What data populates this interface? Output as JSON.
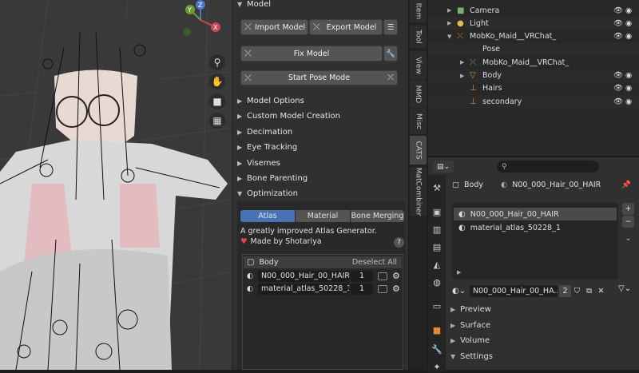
{
  "viewport": {
    "axes": {
      "x": "X",
      "y": "Y",
      "z": "Z"
    },
    "nav_icons": [
      "zoom-icon",
      "hand-pan-icon",
      "camera-icon",
      "grid-icon"
    ]
  },
  "npanel": {
    "model_header": "Model",
    "import_label": "Import Model",
    "export_label": "Export Model",
    "fix_label": "Fix Model",
    "pose_label": "Start Pose Mode",
    "sections": [
      "Model Options",
      "Custom Model Creation",
      "Decimation",
      "Eye Tracking",
      "Visemes",
      "Bone Parenting"
    ],
    "optimization_header": "Optimization",
    "opt_tabs": [
      "Atlas",
      "Material",
      "Bone Merging"
    ],
    "atlas_desc": "A greatly improved Atlas Generator.",
    "made_by": "Made by Shotariya",
    "list_header": "Body",
    "deselect_label": "Deselect All",
    "materials": [
      {
        "name": "N00_000_Hair_00_HAIR",
        "count": "1"
      },
      {
        "name": "material_atlas_50228_1",
        "count": "1"
      }
    ]
  },
  "tabs": [
    "Item",
    "Tool",
    "View",
    "MMD",
    "Misc",
    "CATS",
    "MatCombiner"
  ],
  "outliner": {
    "rows": [
      {
        "label": "Camera",
        "indent": 1,
        "icon": "camera-icon"
      },
      {
        "label": "Light",
        "indent": 1,
        "icon": "light-icon"
      },
      {
        "label": "MobKo_Maid__VRChat_",
        "indent": 1,
        "icon": "armature-icon"
      },
      {
        "label": "Pose",
        "indent": 2,
        "icon": "pose-icon"
      },
      {
        "label": "MobKo_Maid__VRChat_",
        "indent": 2,
        "icon": "armature-data-icon"
      },
      {
        "label": "Body",
        "indent": 2,
        "icon": "mesh-icon"
      },
      {
        "label": "Hairs",
        "indent": 2,
        "icon": "bone-icon"
      },
      {
        "label": "secondary",
        "indent": 2,
        "icon": "bone-icon"
      }
    ]
  },
  "properties": {
    "search_placeholder": "",
    "breadcrumb_object": "Body",
    "breadcrumb_material": "N00_000_Hair_00_HAIR",
    "slots": [
      "N00_000_Hair_00_HAIR",
      "material_atlas_50228_1"
    ],
    "material_field": "N00_000_Hair_00_HA...",
    "user_count": "2",
    "subpanels": [
      "Preview",
      "Surface",
      "Volume",
      "Settings"
    ]
  },
  "colors": {
    "accent": "#4772b3",
    "panel": "#303030",
    "button": "#545454"
  }
}
